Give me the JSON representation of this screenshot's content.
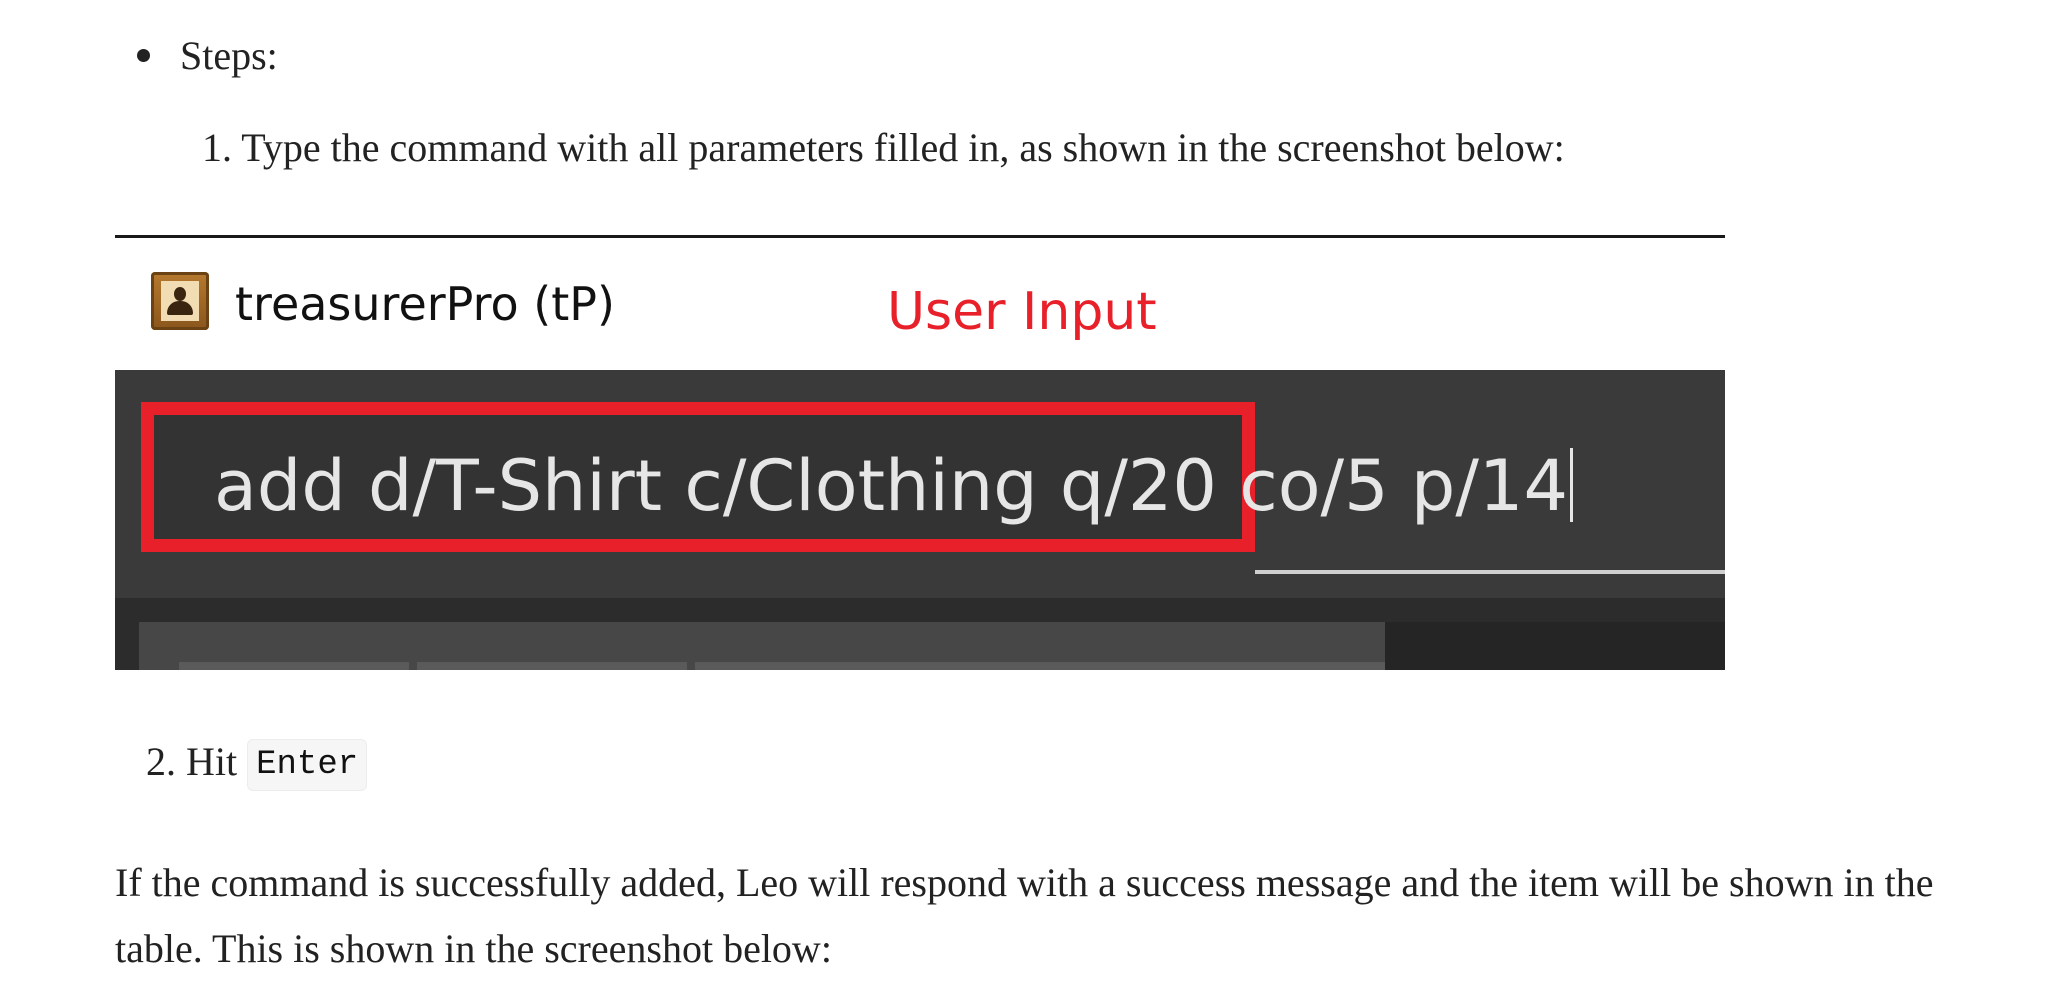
{
  "steps_heading": "Steps:",
  "step_one": {
    "number": "1.",
    "text": "Type the command with all parameters filled in, as shown in the screenshot below:"
  },
  "screenshot": {
    "app_icon": "contact-card-icon",
    "app_title": "treasurerPro (tP)",
    "annotation_label": "User Input",
    "command_text": "add d/T-Shirt c/Clothing q/20 co/5 p/14",
    "colors": {
      "annotation": "#e8202a",
      "command_background": "#3a3a3a",
      "command_text": "#e6e6e6"
    }
  },
  "step_two": {
    "number": "2.",
    "text": "Hit",
    "key": "Enter"
  },
  "paragraph": "If the command is successfully added, Leo will respond with a success message and the item will be shown in the table. This is shown in the screenshot below:"
}
